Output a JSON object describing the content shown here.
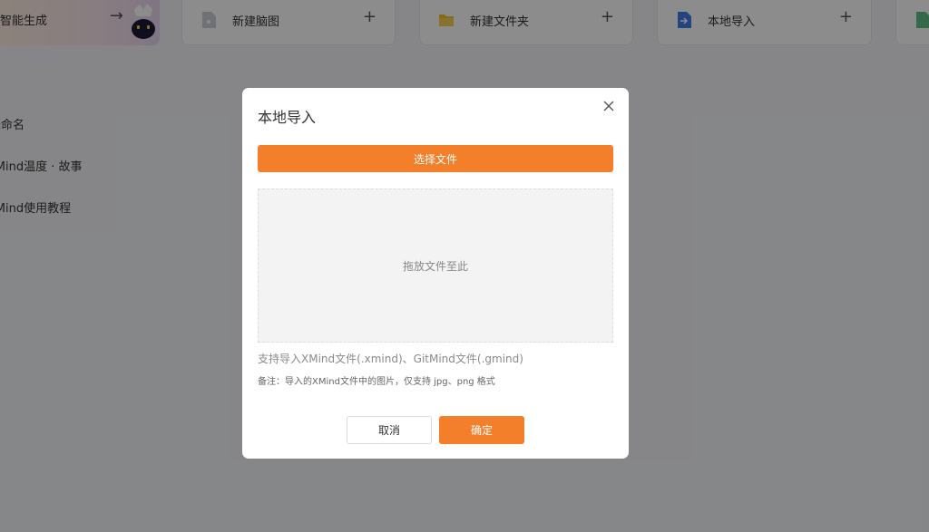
{
  "cards": {
    "ai": {
      "label": "智能生成",
      "icon": "arrow-right-icon"
    },
    "new_mind": {
      "label": "新建脑图",
      "icon": "mindmap-file-icon",
      "action": "+"
    },
    "new_folder": {
      "label": "新建文件夹",
      "icon": "folder-icon",
      "action": "+"
    },
    "local_import": {
      "label": "本地导入",
      "icon": "import-file-icon",
      "action": "+"
    }
  },
  "recent": {
    "items": [
      "未命名",
      "GitMind温度 · 故事",
      "GitMind使用教程"
    ]
  },
  "modal": {
    "title": "本地导入",
    "select_button": "选择文件",
    "drop_hint": "拖放文件至此",
    "support_text": "支持导入XMind文件(.xmind)、GitMind文件(.gmind)",
    "note_text": "备注：导入的XMind文件中的图片，仅支持 jpg、png 格式",
    "cancel_label": "取消",
    "ok_label": "确定"
  },
  "colors": {
    "accent": "#f47f2a",
    "overlay": "#000000"
  }
}
